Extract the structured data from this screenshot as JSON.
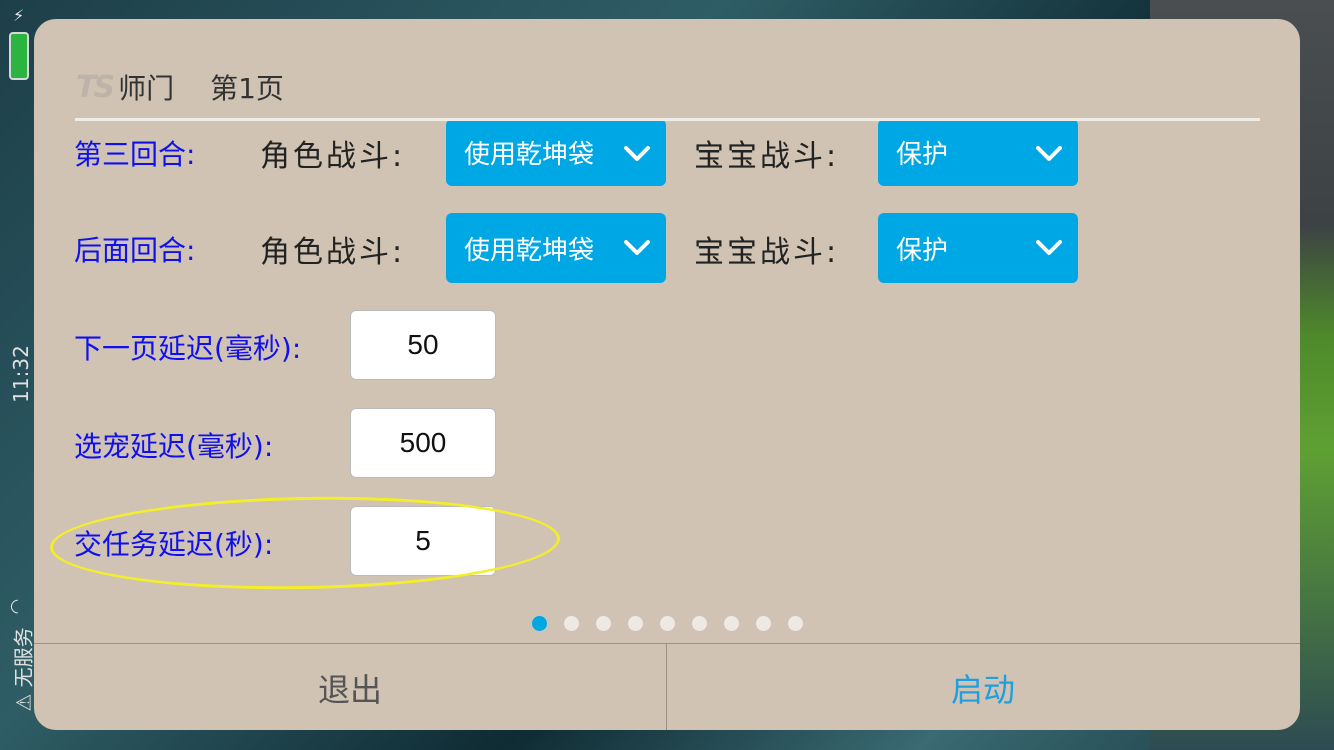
{
  "status_bar": {
    "time": "11:32",
    "carrier": "无服务"
  },
  "dialog": {
    "logo": "TS",
    "title": "师门",
    "page_label": "第1页"
  },
  "rows": {
    "round3": {
      "label": "第三回合:",
      "role_label": "角色战斗:",
      "role_value": "使用乾坤袋",
      "pet_label": "宝宝战斗:",
      "pet_value": "保护"
    },
    "later": {
      "label": "后面回合:",
      "role_label": "角色战斗:",
      "role_value": "使用乾坤袋",
      "pet_label": "宝宝战斗:",
      "pet_value": "保护"
    }
  },
  "delays": {
    "next_page": {
      "label": "下一页延迟(毫秒):",
      "value": "50"
    },
    "select_pet": {
      "label": "选宠延迟(毫秒):",
      "value": "500"
    },
    "submit_task": {
      "label": "交任务延迟(秒):",
      "value": "5"
    }
  },
  "pager": {
    "total": 9,
    "active_index": 0
  },
  "buttons": {
    "exit": "退出",
    "start": "启动"
  },
  "colors": {
    "dialog_bg": "#d0c3b4",
    "accent": "#00a7e5",
    "label_blue": "#1010ee",
    "highlight": "#f4ee2a"
  }
}
